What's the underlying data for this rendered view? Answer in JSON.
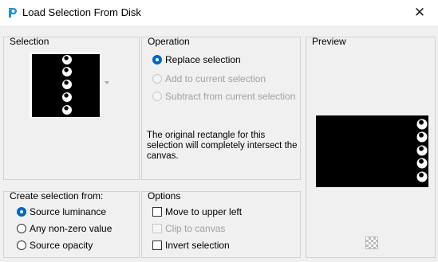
{
  "window": {
    "title": "Load Selection From Disk",
    "close_glyph": "✕"
  },
  "selection_panel": {
    "title": "Selection"
  },
  "operation_panel": {
    "title": "Operation",
    "options": [
      {
        "label": "Replace selection",
        "checked": true,
        "enabled": true
      },
      {
        "label": "Add to current selection",
        "checked": false,
        "enabled": false
      },
      {
        "label": "Subtract from current selection",
        "checked": false,
        "enabled": false
      }
    ],
    "note": "The original rectangle for this selection will completely intersect the canvas."
  },
  "preview_panel": {
    "title": "Preview"
  },
  "create_panel": {
    "title": "Create selection from:",
    "options": [
      {
        "label": "Source luminance",
        "checked": true
      },
      {
        "label": "Any non-zero value",
        "checked": false
      },
      {
        "label": "Source opacity",
        "checked": false
      }
    ]
  },
  "options_panel": {
    "title": "Options",
    "checkboxes": [
      {
        "label": "Move to upper left",
        "checked": false,
        "enabled": true
      },
      {
        "label": "Clip to canvas",
        "checked": false,
        "enabled": false
      },
      {
        "label": "Invert selection",
        "checked": false,
        "enabled": true
      }
    ]
  },
  "colors": {
    "accent": "#0067c0",
    "image_background": "#000000",
    "image_marks": "#ffffff"
  },
  "icons": [
    "app-icon",
    "close-icon",
    "dropdown-arrow-icon",
    "ring-mark-icon",
    "checkerboard-icon"
  ]
}
